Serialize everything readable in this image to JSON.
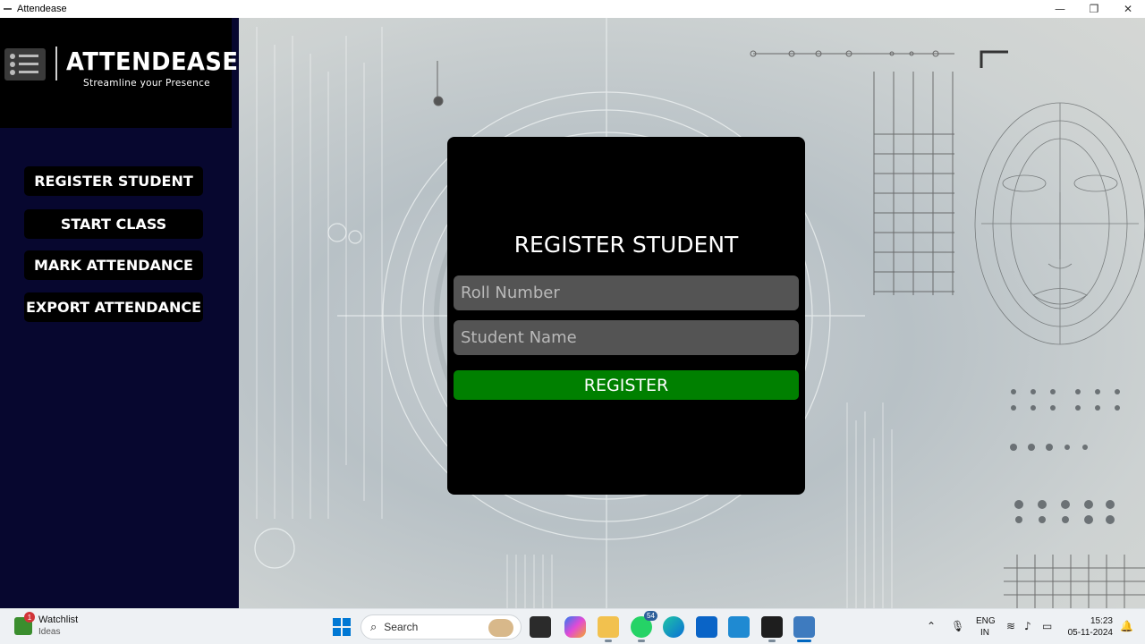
{
  "window": {
    "title": "Attendease",
    "minimize_icon": "—",
    "maximize_icon": "❐",
    "close_icon": "✕"
  },
  "logo": {
    "title": "ATTENDEASE",
    "tagline": "Streamline your Presence"
  },
  "sidebar": {
    "items": [
      {
        "label": "REGISTER STUDENT"
      },
      {
        "label": "START CLASS"
      },
      {
        "label": "MARK ATTENDANCE"
      },
      {
        "label": "EXPORT ATTENDANCE"
      }
    ]
  },
  "dialog": {
    "title": "REGISTER STUDENT",
    "roll_placeholder": "Roll Number",
    "name_placeholder": "Student Name",
    "register_label": "REGISTER"
  },
  "taskbar": {
    "widget_title": "Watchlist",
    "widget_sub": "Ideas",
    "widget_badge": "1",
    "search_label": "Search",
    "whatsapp_badge": "54",
    "lang_top": "ENG",
    "lang_bottom": "IN",
    "time": "15:23",
    "date": "05-11-2024"
  },
  "colors": {
    "sidebar_bg": "#07072f",
    "dialog_bg": "#000000",
    "field_bg": "#545454",
    "register_button": "#008000"
  }
}
